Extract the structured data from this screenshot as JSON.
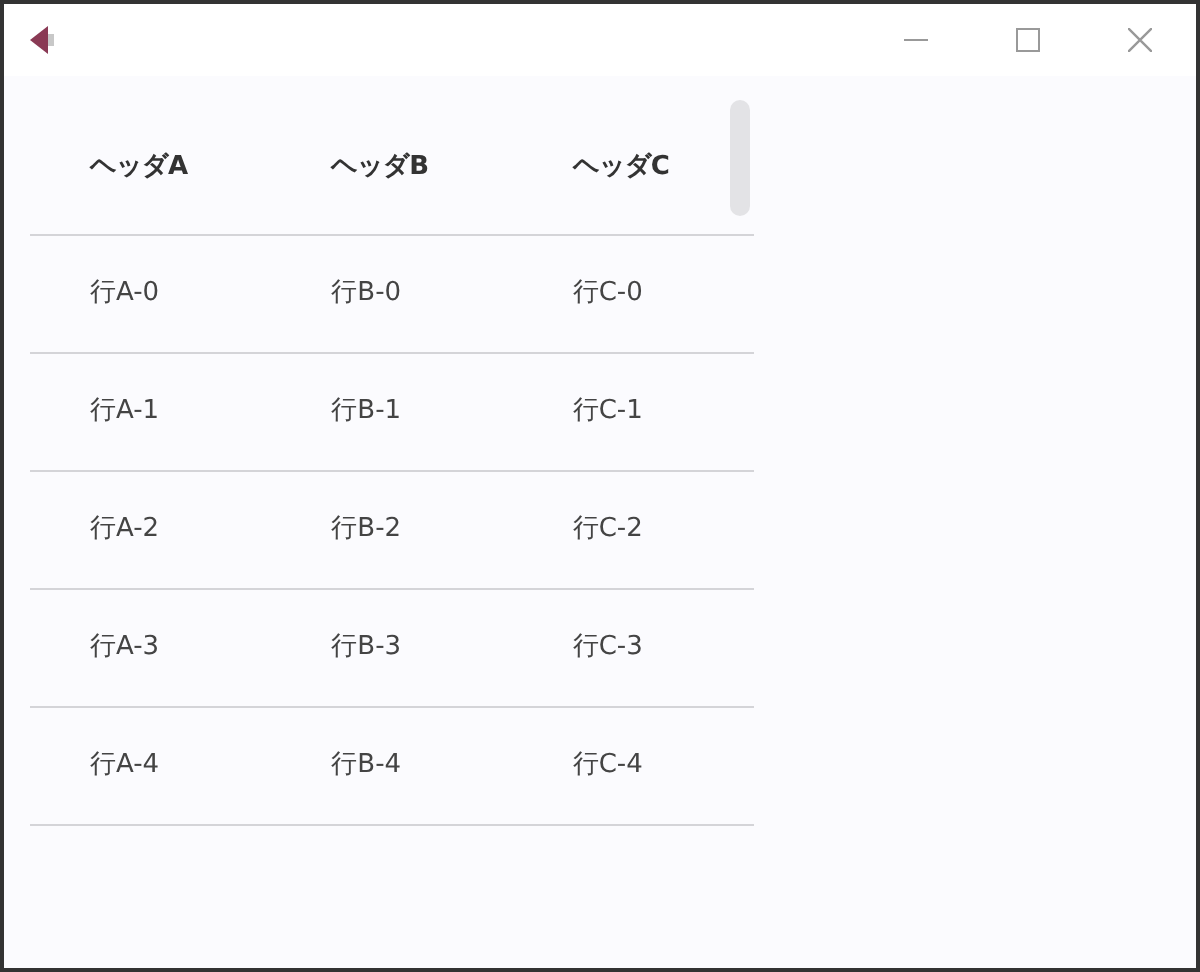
{
  "table": {
    "columns": [
      "ヘッダA",
      "ヘッダB",
      "ヘッダC"
    ],
    "rows": [
      [
        "行A-0",
        "行B-0",
        "行C-0"
      ],
      [
        "行A-1",
        "行B-1",
        "行C-1"
      ],
      [
        "行A-2",
        "行B-2",
        "行C-2"
      ],
      [
        "行A-3",
        "行B-3",
        "行C-3"
      ],
      [
        "行A-4",
        "行B-4",
        "行C-4"
      ]
    ]
  }
}
